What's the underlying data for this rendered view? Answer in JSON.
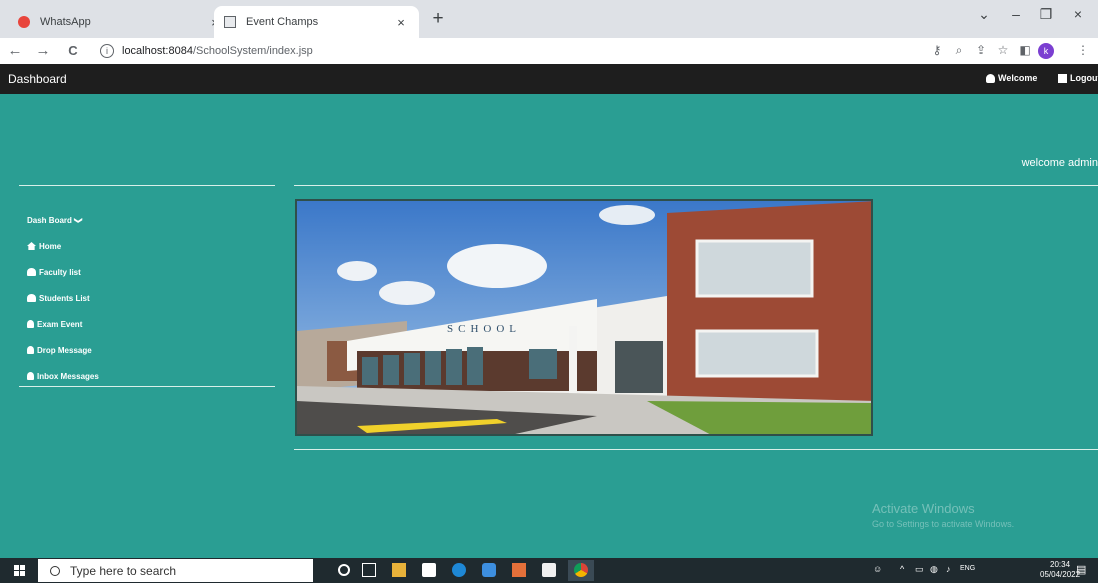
{
  "browser": {
    "tabs": [
      {
        "title": "WhatsApp",
        "close": "×"
      },
      {
        "title": "Event Champs",
        "close": "×"
      }
    ],
    "new_tab": "+",
    "window_controls": {
      "minimize": "–",
      "maximize": "❐",
      "close": "×",
      "tab_search": "⌄"
    },
    "nav": {
      "back": "←",
      "forward": "→",
      "reload": "C"
    },
    "address": {
      "host": "localhost:8084",
      "path": "/SchoolSystem/index.jsp",
      "info": "i"
    },
    "profile_initial": "k"
  },
  "app": {
    "brand": "Dashboard",
    "header_links": {
      "welcome": "Welcome",
      "logout": "Logout"
    },
    "welcome_message": "welcome admin",
    "menu": {
      "title": "Dash Board",
      "chevron": "❯",
      "items": [
        {
          "label": "Home",
          "icon": "home-icon"
        },
        {
          "label": "Faculty list",
          "icon": "user-icon"
        },
        {
          "label": "Students List",
          "icon": "user-icon"
        },
        {
          "label": "Exam Event",
          "icon": "bell-icon"
        },
        {
          "label": "Drop Message",
          "icon": "bell-icon"
        },
        {
          "label": "Inbox Messages",
          "icon": "bell-icon"
        }
      ]
    },
    "image": {
      "sign_text": "SCHOOL"
    }
  },
  "watermark": {
    "line1": "Activate Windows",
    "line2": "Go to Settings to activate Windows."
  },
  "taskbar": {
    "search_placeholder": "Type here to search",
    "tray": {
      "language": "ENG",
      "time": "20:34",
      "date": "05/04/2022"
    }
  },
  "colors": {
    "page_bg": "#2a9e93",
    "header_bg": "#1e1e1e",
    "taskbar_bg": "#1f2a2f"
  }
}
